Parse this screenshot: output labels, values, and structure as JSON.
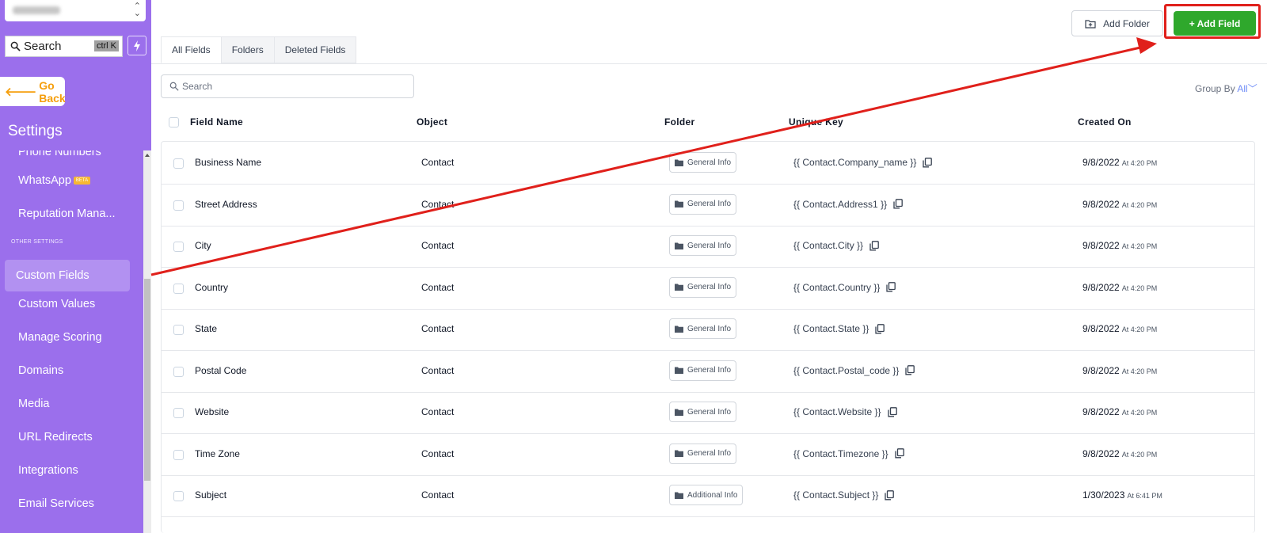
{
  "sidebar": {
    "search_label": "Search",
    "search_shortcut": "ctrl K",
    "go_back": "Go Back",
    "title": "Settings",
    "items_top": [
      {
        "label": "Phone Numbers"
      },
      {
        "label": "WhatsApp",
        "badge": "BETA"
      },
      {
        "label": "Reputation Mana..."
      }
    ],
    "group_label": "OTHER SETTINGS",
    "active_item": "Custom Fields",
    "items_bottom": [
      "Custom Values",
      "Manage Scoring",
      "Domains",
      "Media",
      "URL Redirects",
      "Integrations",
      "Email Services"
    ]
  },
  "toolbar": {
    "add_folder": "Add Folder",
    "add_field": "+ Add Field"
  },
  "tabs": [
    "All Fields",
    "Folders",
    "Deleted Fields"
  ],
  "search": {
    "placeholder": "Search"
  },
  "group_by": {
    "label": "Group By",
    "value": "All"
  },
  "table": {
    "headers": [
      "Field Name",
      "Object",
      "Folder",
      "Unique Key",
      "Created On"
    ],
    "rows": [
      {
        "name": "Business Name",
        "object": "Contact",
        "folder": "General Info",
        "key": "{{ Contact.Company_name }}",
        "date": "9/8/2022",
        "time": "At 4:20 PM"
      },
      {
        "name": "Street Address",
        "object": "Contact",
        "folder": "General Info",
        "key": "{{ Contact.Address1 }}",
        "date": "9/8/2022",
        "time": "At 4:20 PM"
      },
      {
        "name": "City",
        "object": "Contact",
        "folder": "General Info",
        "key": "{{ Contact.City }}",
        "date": "9/8/2022",
        "time": "At 4:20 PM"
      },
      {
        "name": "Country",
        "object": "Contact",
        "folder": "General Info",
        "key": "{{ Contact.Country }}",
        "date": "9/8/2022",
        "time": "At 4:20 PM"
      },
      {
        "name": "State",
        "object": "Contact",
        "folder": "General Info",
        "key": "{{ Contact.State }}",
        "date": "9/8/2022",
        "time": "At 4:20 PM"
      },
      {
        "name": "Postal Code",
        "object": "Contact",
        "folder": "General Info",
        "key": "{{ Contact.Postal_code }}",
        "date": "9/8/2022",
        "time": "At 4:20 PM"
      },
      {
        "name": "Website",
        "object": "Contact",
        "folder": "General Info",
        "key": "{{ Contact.Website }}",
        "date": "9/8/2022",
        "time": "At 4:20 PM"
      },
      {
        "name": "Time Zone",
        "object": "Contact",
        "folder": "General Info",
        "key": "{{ Contact.Timezone }}",
        "date": "9/8/2022",
        "time": "At 4:20 PM"
      },
      {
        "name": "Subject",
        "object": "Contact",
        "folder": "Additional Info",
        "key": "{{ Contact.Subject }}",
        "date": "1/30/2023",
        "time": "At 6:41 PM"
      }
    ]
  },
  "colors": {
    "sidebar_bg": "#9b6fec",
    "active_nav_bg": "#b291f1",
    "add_field_bg": "#2fa82c",
    "go_back_text": "#f59e0b",
    "annotation_red": "#e0201b"
  }
}
